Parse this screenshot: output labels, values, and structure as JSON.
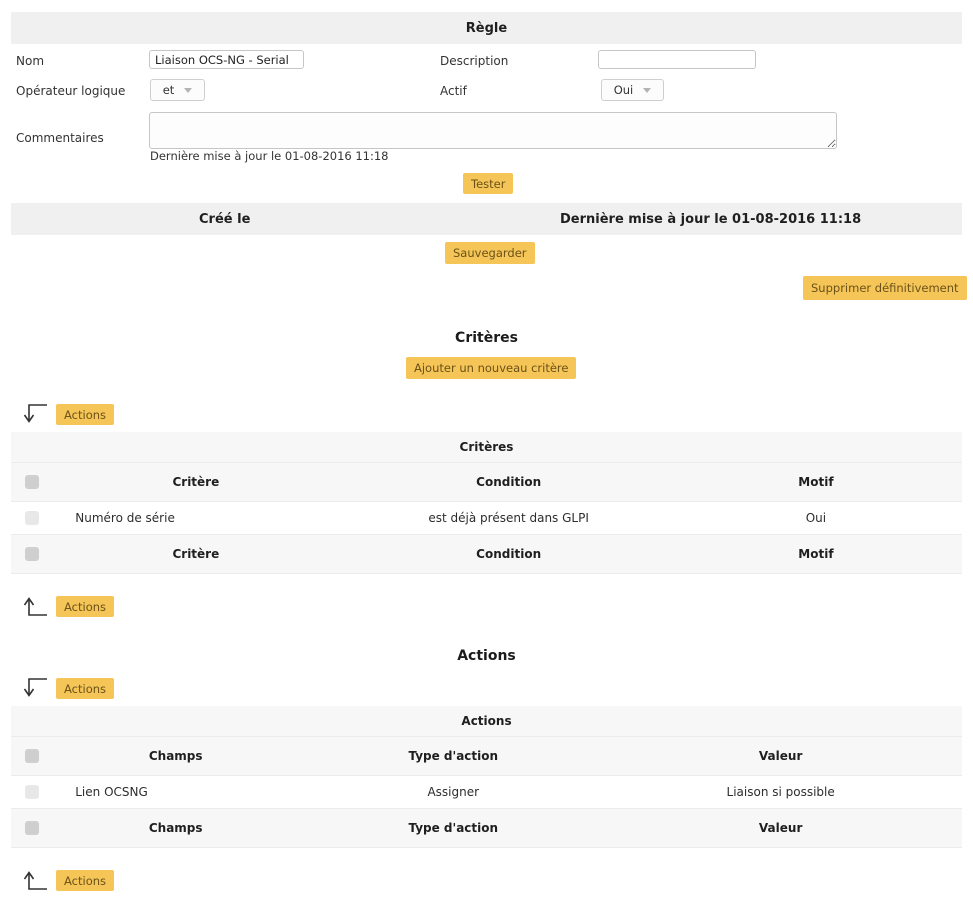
{
  "rule_panel": {
    "title": "Règle",
    "fields": {
      "nom_label": "Nom",
      "nom_value": "Liaison OCS-NG - Serial",
      "nom_placeholder": "",
      "description_label": "Description",
      "description_value": "",
      "description_placeholder": "",
      "operateur_label": "Opérateur logique",
      "operateur_value": "et",
      "actif_label": "Actif",
      "actif_value": "Oui",
      "commentaires_label": "Commentaires",
      "commentaires_value": "",
      "commentaires_placeholder": ""
    },
    "updated_note": "Dernière mise à jour le 01-08-2016 11:18",
    "test_button": "Tester",
    "meta_bar": {
      "created_label": "Créé le",
      "updated_label": "Dernière mise à jour le 01-08-2016 11:18"
    },
    "save_button": "Sauvegarder",
    "delete_button": "Supprimer définitivement"
  },
  "criteria_section": {
    "heading": "Critères",
    "add_button": "Ajouter un nouveau critère",
    "actions_button_top": "Actions",
    "actions_button_bottom": "Actions",
    "arrow_down_icon": "arrow-down-icon",
    "arrow_up_icon": "arrow-up-icon",
    "table": {
      "caption": "Critères",
      "columns": [
        "Critère",
        "Condition",
        "Motif"
      ],
      "rows": [
        {
          "critere": "Numéro de série",
          "condition": "est déjà présent dans GLPI",
          "motif": "Oui"
        }
      ]
    }
  },
  "actions_section": {
    "heading": "Actions",
    "actions_button_top": "Actions",
    "actions_button_bottom": "Actions",
    "arrow_down_icon": "arrow-down-icon",
    "arrow_up_icon": "arrow-up-icon",
    "table": {
      "caption": "Actions",
      "columns": [
        "Champs",
        "Type d'action",
        "Valeur"
      ],
      "rows": [
        {
          "champs": "Lien OCSNG",
          "type_action": "Assigner",
          "valeur": "Liaison si possible"
        }
      ]
    }
  },
  "colors": {
    "accent_button": "#f5c558",
    "accent_button_text": "#6b5218",
    "band_gray": "#f0f0f0",
    "table_header_gray": "#f7f7f7",
    "checkbox_dark": "#cfcfcf",
    "checkbox_light": "#e8e8e8"
  }
}
